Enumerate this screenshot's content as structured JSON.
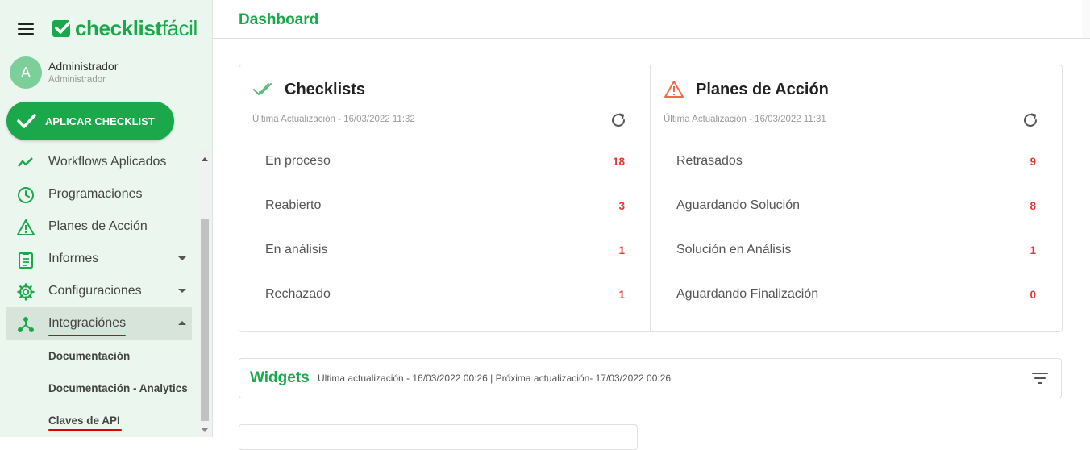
{
  "app": {
    "logo_bold": "checklist",
    "logo_light": "fácil",
    "brand_color": "#1aa84b"
  },
  "user": {
    "initial": "A",
    "name": "Administrador",
    "role": "Administrador"
  },
  "sidebar": {
    "apply_button": "APLICAR CHECKLIST",
    "items": [
      {
        "label": "Workflows Aplicados",
        "icon": "trending-icon"
      },
      {
        "label": "Programaciones",
        "icon": "clock-icon"
      },
      {
        "label": "Planes de Acción",
        "icon": "warning-icon"
      },
      {
        "label": "Informes",
        "icon": "clipboard-icon"
      },
      {
        "label": "Configuraciones",
        "icon": "gear-icon"
      },
      {
        "label": "Integraciónes",
        "icon": "integration-icon"
      }
    ],
    "subitems": [
      {
        "label": "Documentación"
      },
      {
        "label": "Documentación - Analytics"
      },
      {
        "label": "Claves de API"
      }
    ]
  },
  "header": {
    "title": "Dashboard"
  },
  "checklists": {
    "title": "Checklists",
    "updated": "Última Actualización - 16/03/2022 11:32",
    "rows": [
      {
        "label": "En proceso",
        "value": "18"
      },
      {
        "label": "Reabierto",
        "value": "3"
      },
      {
        "label": "En análisis",
        "value": "1"
      },
      {
        "label": "Rechazado",
        "value": "1"
      }
    ]
  },
  "action_plans": {
    "title": "Planes de Acción",
    "updated": "Última Actualización - 16/03/2022 11:31",
    "rows": [
      {
        "label": "Retrasados",
        "value": "9"
      },
      {
        "label": "Aguardando Solución",
        "value": "8"
      },
      {
        "label": "Solución en Análisis",
        "value": "1"
      },
      {
        "label": "Aguardando Finalización",
        "value": "0"
      }
    ]
  },
  "widgets": {
    "title": "Widgets",
    "meta": "Ultima actualización - 16/03/2022 00:26 | Próxima actualización- 17/03/2022 00:26"
  }
}
